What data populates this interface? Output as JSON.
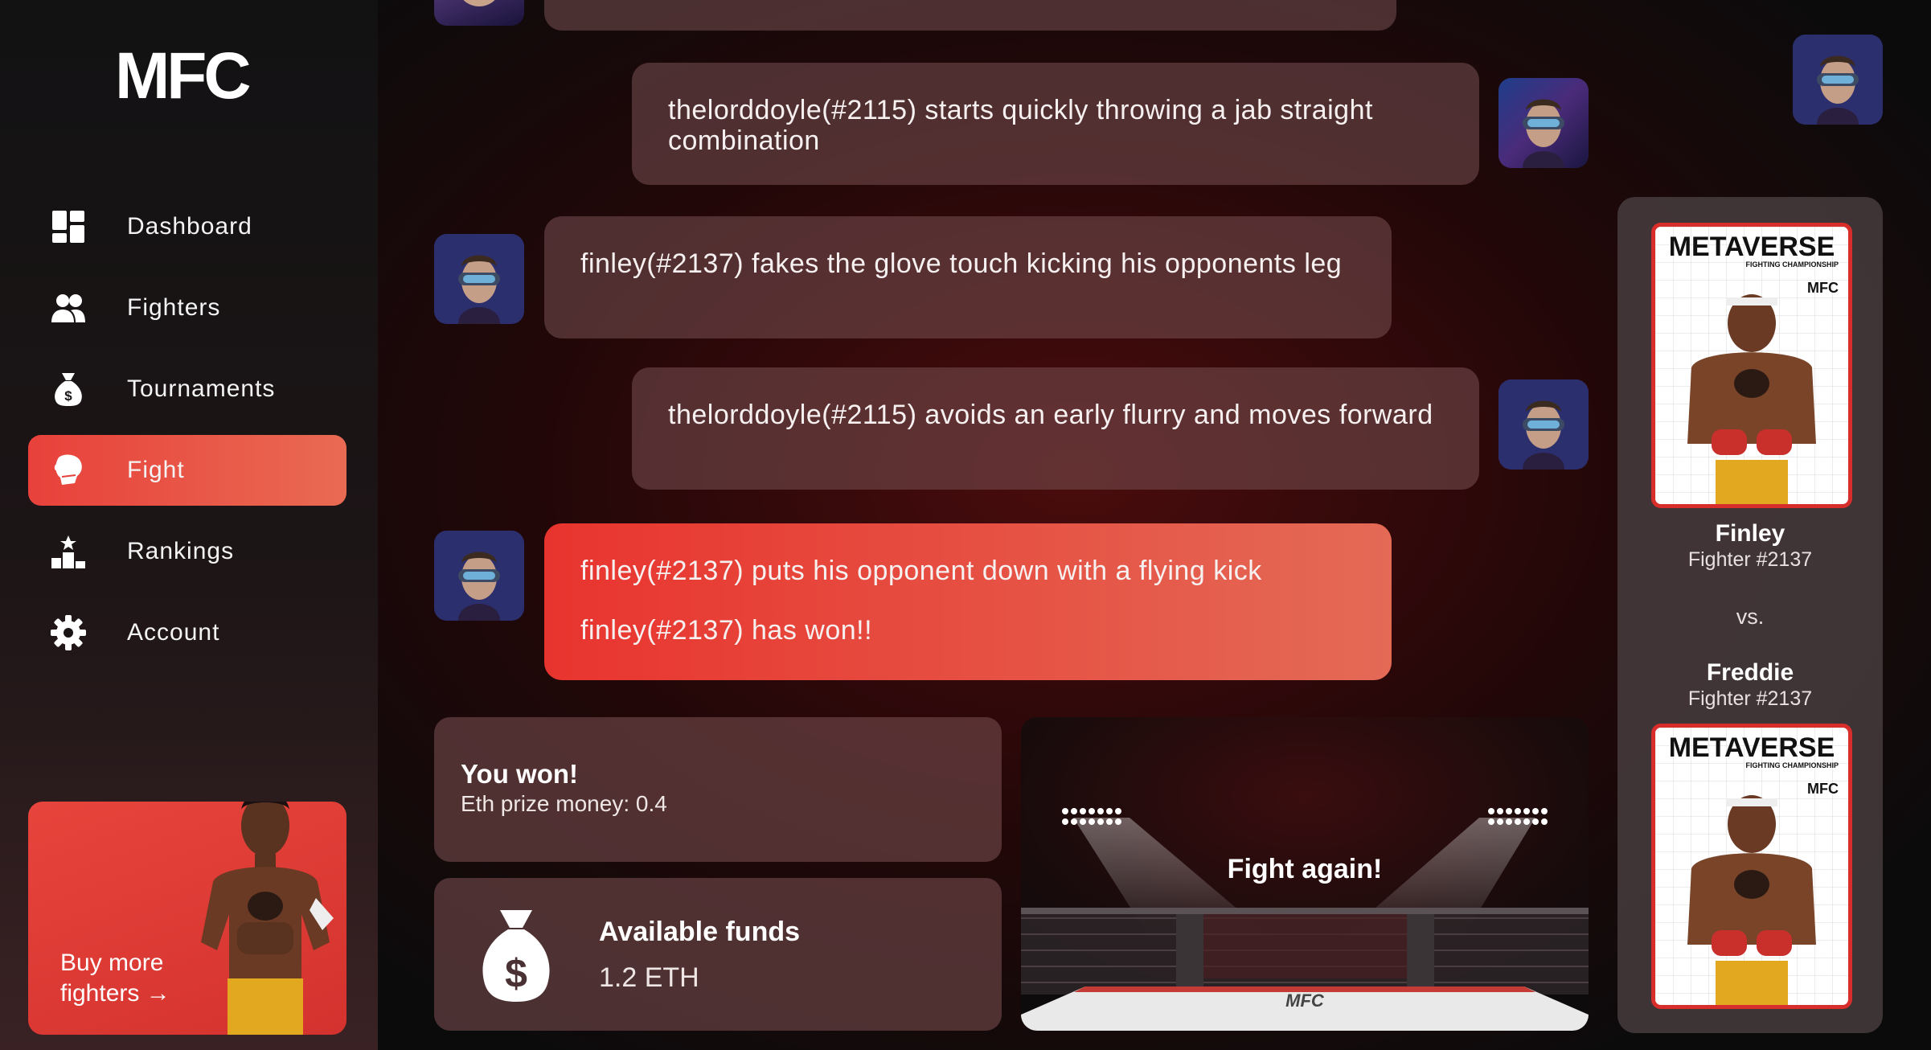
{
  "brand": {
    "logo": "MFC"
  },
  "sidebar": {
    "items": [
      {
        "label": "Dashboard",
        "icon": "dashboard-icon",
        "active": false
      },
      {
        "label": "Fighters",
        "icon": "users-icon",
        "active": false
      },
      {
        "label": "Tournaments",
        "icon": "money-bag-icon",
        "active": false
      },
      {
        "label": "Fight",
        "icon": "boxing-glove-icon",
        "active": true
      },
      {
        "label": "Rankings",
        "icon": "podium-icon",
        "active": false
      },
      {
        "label": "Account",
        "icon": "gear-icon",
        "active": false
      }
    ],
    "promo": {
      "label": "Buy more fighters →"
    }
  },
  "feed": {
    "messages": [
      {
        "side": "right",
        "text": "thelorddoyle(#2115) starts quickly throwing a jab straight combination"
      },
      {
        "side": "left",
        "text": "finley(#2137) fakes the glove touch kicking his opponents leg"
      },
      {
        "side": "right",
        "text": "thelorddoyle(#2115) avoids an early flurry and moves forward"
      },
      {
        "side": "left",
        "type": "win",
        "text": "finley(#2137) puts his opponent down with a flying kick",
        "result": "finley(#2137) has won!!"
      }
    ]
  },
  "result": {
    "title": "You won!",
    "prize_label": "Eth prize money: 0.4"
  },
  "funds": {
    "title": "Available funds",
    "value": "1.2 ETH"
  },
  "arena": {
    "label": "Fight again!",
    "ring_logo": "MFC"
  },
  "matchup": {
    "card_title": "METAVERSE",
    "card_subtitle": "FIGHTING CHAMPIONSHIP",
    "card_brand": "MFC",
    "fighter1": {
      "name": "Finley",
      "id": "Fighter #2137"
    },
    "vs": "vs.",
    "fighter2": {
      "name": "Freddie",
      "id": "Fighter #2137"
    }
  },
  "colors": {
    "accent": "#e8413b",
    "accent_light": "#e96a52",
    "card_border": "#d72d2b"
  }
}
